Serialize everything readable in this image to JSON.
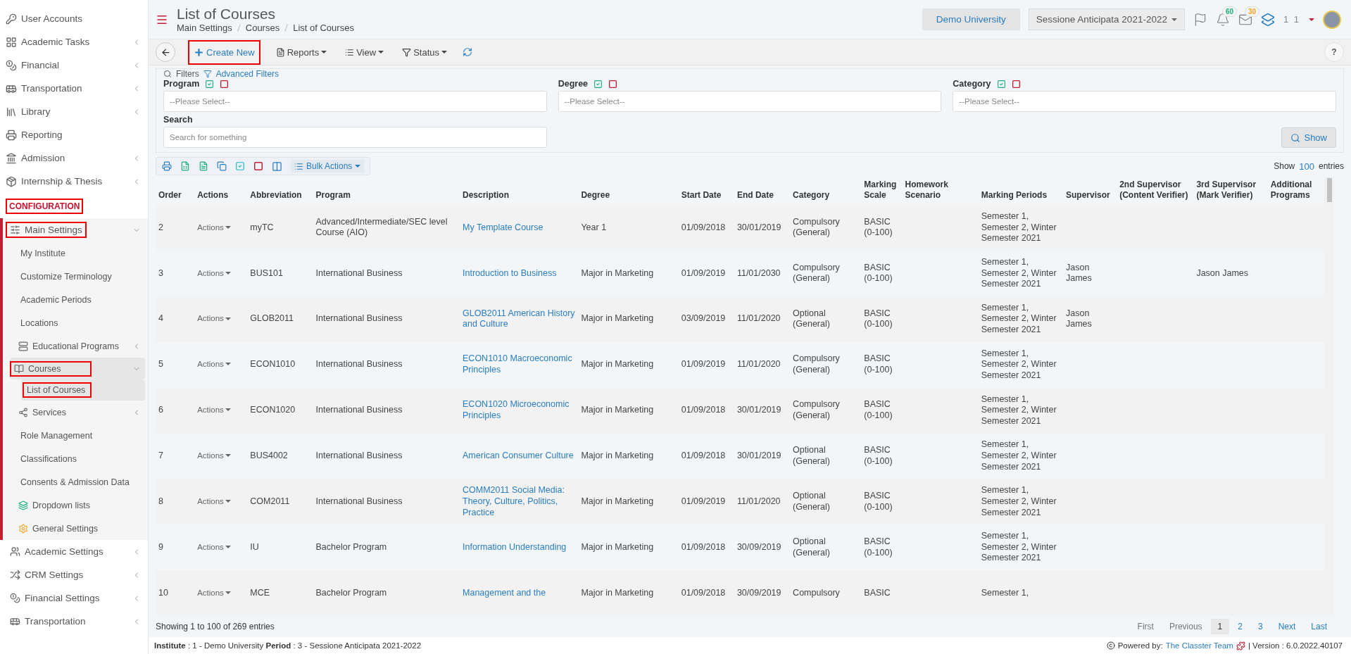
{
  "sidebar": {
    "items": [
      {
        "label": "User Accounts",
        "submenu": false,
        "expanded": false
      },
      {
        "label": "Academic Tasks",
        "submenu": true,
        "expanded": false
      },
      {
        "label": "Financial",
        "submenu": true,
        "expanded": false
      },
      {
        "label": "Transportation",
        "submenu": true,
        "expanded": false
      },
      {
        "label": "Library",
        "submenu": true,
        "expanded": false
      },
      {
        "label": "Reporting",
        "submenu": false,
        "expanded": false
      },
      {
        "label": "Admission",
        "submenu": true,
        "expanded": false
      },
      {
        "label": "Internship & Thesis",
        "submenu": true,
        "expanded": false
      }
    ],
    "section": {
      "label": "CONFIGURATION",
      "highlighted": true
    },
    "config_items": [
      {
        "label": "Main Settings",
        "expanded": true,
        "highlighted": true,
        "children": [
          {
            "label": "My Institute",
            "submenu": false,
            "expanded": false,
            "selected": false,
            "highlighted": false
          },
          {
            "label": "Customize Terminology",
            "submenu": false,
            "expanded": false,
            "selected": false,
            "highlighted": false
          },
          {
            "label": "Academic Periods",
            "submenu": false,
            "expanded": false,
            "selected": false,
            "highlighted": false
          },
          {
            "label": "Locations",
            "submenu": false,
            "expanded": false,
            "selected": false,
            "highlighted": false
          },
          {
            "label": "Educational Programs",
            "submenu": true,
            "expanded": false,
            "selected": false,
            "highlighted": false
          },
          {
            "label": "Courses",
            "expanded": true,
            "selected": true,
            "highlighted": true,
            "children": [
              {
                "label": "List of Courses",
                "selected": true,
                "highlighted": true
              }
            ]
          },
          {
            "label": "Services",
            "submenu": true,
            "expanded": false,
            "selected": false,
            "highlighted": false
          },
          {
            "label": "Role Management",
            "submenu": false,
            "expanded": false,
            "selected": false,
            "highlighted": false
          },
          {
            "label": "Classifications",
            "submenu": false,
            "expanded": false,
            "selected": false,
            "highlighted": false
          },
          {
            "label": "Consents & Admission Data",
            "submenu": false,
            "expanded": false,
            "selected": false,
            "highlighted": false
          },
          {
            "label": "Dropdown lists",
            "submenu": false,
            "expanded": false,
            "selected": false,
            "highlighted": false
          },
          {
            "label": "General Settings",
            "submenu": false,
            "expanded": false,
            "selected": false,
            "highlighted": false
          }
        ]
      },
      {
        "label": "Academic Settings",
        "submenu": true,
        "expanded": false,
        "highlighted": false
      },
      {
        "label": "CRM Settings",
        "submenu": true,
        "expanded": false,
        "highlighted": false
      },
      {
        "label": "Financial Settings",
        "submenu": true,
        "expanded": false,
        "highlighted": false
      },
      {
        "label": "Transportation",
        "submenu": true,
        "expanded": false,
        "highlighted": false
      }
    ]
  },
  "header": {
    "title": "List of Courses",
    "breadcrumb": [
      "Main Settings",
      "Courses",
      "List of Courses"
    ],
    "institute": "Demo University",
    "period": "Sessione Anticipata 2021-2022",
    "badges": [
      {
        "count": "60",
        "color": "#1aae7a"
      },
      {
        "count": "30",
        "color": "#f5a623"
      }
    ],
    "user": "1 1"
  },
  "toolbar": {
    "buttons": [
      {
        "kind": "create",
        "label": "Create New",
        "highlighted": true
      },
      {
        "kind": "reports",
        "label": "Reports",
        "highlighted": false
      },
      {
        "kind": "view",
        "label": "View",
        "highlighted": false
      },
      {
        "kind": "status",
        "label": "Status",
        "highlighted": false
      }
    ],
    "help": "?"
  },
  "filters": {
    "title": "Filters",
    "advanced": "Advanced Filters",
    "fields": [
      {
        "label": "Program",
        "placeholder": "--Please Select--"
      },
      {
        "label": "Degree",
        "placeholder": "--Please Select--"
      },
      {
        "label": "Category",
        "placeholder": "--Please Select--"
      }
    ],
    "search": {
      "label": "Search",
      "placeholder": "Search for something"
    },
    "show": "Show"
  },
  "table_tools": {
    "bulk": "Bulk Actions",
    "show": "Show",
    "count": "100",
    "entries": "entries"
  },
  "table": {
    "columns": [
      "Order",
      "Actions",
      "Abbreviation",
      "Program",
      "Description",
      "Degree",
      "Start Date",
      "End Date",
      "Category",
      "Marking Scale",
      "Homework Scenario",
      "Marking Periods",
      "Supervisor",
      "2nd Supervisor (Content Verifier)",
      "3rd Supervisor (Mark Verifier)",
      "Additional Programs"
    ],
    "rows": [
      {
        "order": "2",
        "actions": "Actions",
        "abbreviation": "myTC",
        "program": "Advanced/Intermediate/SEC level Course (AIO)",
        "description": "My Template Course",
        "degree": "Year 1",
        "start": "01/09/2018",
        "end": "30/01/2019",
        "category": "Compulsory (General)",
        "scale": "BASIC (0-100)",
        "periods": "Semester 1, Semester 2, Winter Semester 2021"
      },
      {
        "order": "3",
        "actions": "Actions",
        "abbreviation": "BUS101",
        "program": "International Business",
        "description": "Introduction to Business",
        "degree": "Major in Marketing",
        "start": "01/09/2019",
        "end": "11/01/2030",
        "category": "Compulsory (General)",
        "scale": "BASIC (0-100)",
        "periods": "Semester 1, Semester 2, Winter Semester 2021",
        "supervisor": "Jason James",
        "supervisor3": "Jason James"
      },
      {
        "order": "4",
        "actions": "Actions",
        "abbreviation": "GLOB2011",
        "program": "International Business",
        "description": "GLOB2011 American History and Culture",
        "degree": "Major in Marketing",
        "start": "03/09/2019",
        "end": "11/01/2020",
        "category": "Optional (General)",
        "scale": "BASIC (0-100)",
        "periods": "Semester 1, Semester 2, Winter Semester 2021",
        "supervisor": "Jason James"
      },
      {
        "order": "5",
        "actions": "Actions",
        "abbreviation": "ECON1010",
        "program": "International Business",
        "description": "ECON1010 Macroeconomic Principles",
        "degree": "Major in Marketing",
        "start": "01/09/2019",
        "end": "11/01/2020",
        "category": "Compulsory (General)",
        "scale": "BASIC (0-100)",
        "periods": "Semester 1, Semester 2, Winter Semester 2021"
      },
      {
        "order": "6",
        "actions": "Actions",
        "abbreviation": "ECON1020",
        "program": "International Business",
        "description": "ECON1020 Microeconomic Principles",
        "degree": "Major in Marketing",
        "start": "01/09/2018",
        "end": "30/01/2019",
        "category": "Compulsory (General)",
        "scale": "BASIC (0-100)",
        "periods": "Semester 1, Semester 2, Winter Semester 2021"
      },
      {
        "order": "7",
        "actions": "Actions",
        "abbreviation": "BUS4002",
        "program": "International Business",
        "description": "American Consumer Culture",
        "degree": "Major in Marketing",
        "start": "01/09/2018",
        "end": "30/01/2019",
        "category": "Optional (General)",
        "scale": "BASIC (0-100)",
        "periods": "Semester 1, Semester 2, Winter Semester 2021"
      },
      {
        "order": "8",
        "actions": "Actions",
        "abbreviation": "COM2011",
        "program": "International Business",
        "description": "COMM2011 Social Media: Theory, Culture, Politics, Practice",
        "degree": "Major in Marketing",
        "start": "01/09/2019",
        "end": "11/01/2020",
        "category": "Optional (General)",
        "scale": "BASIC (0-100)",
        "periods": "Semester 1, Semester 2, Winter Semester 2021"
      },
      {
        "order": "9",
        "actions": "Actions",
        "abbreviation": "IU",
        "program": "Bachelor Program",
        "description": "Information Understanding",
        "degree": "Major in Marketing",
        "start": "01/09/2018",
        "end": "30/09/2019",
        "category": "Optional (General)",
        "scale": "BASIC (0-100)",
        "periods": "Semester 1, Semester 2, Winter Semester 2021"
      },
      {
        "order": "10",
        "actions": "Actions",
        "abbreviation": "MCE",
        "program": "Bachelor Program",
        "description": "Management and the",
        "degree": "Major in Marketing",
        "start": "01/09/2018",
        "end": "30/09/2019",
        "category": "Compulsory",
        "scale": "BASIC",
        "periods": "Semester 1,"
      }
    ]
  },
  "pagination": {
    "info": "Showing 1 to 100 of 269 entries",
    "pages": [
      {
        "label": "First",
        "kind": "nav",
        "selected": false
      },
      {
        "label": "Previous",
        "kind": "nav",
        "selected": false
      },
      {
        "label": "1",
        "kind": "page",
        "selected": true
      },
      {
        "label": "2",
        "kind": "page",
        "selected": false
      },
      {
        "label": "3",
        "kind": "page",
        "selected": false
      },
      {
        "label": "Next",
        "kind": "link",
        "selected": false
      },
      {
        "label": "Last",
        "kind": "link",
        "selected": false
      }
    ]
  },
  "status_bar": {
    "info": "**Institute** : 1 - Demo University **Period** : 3 - Sessione Anticipata 2021-2022",
    "powered": "Powered by:",
    "team": "The Classter Team",
    "version": "| Version : 6.0.2022.40107"
  }
}
